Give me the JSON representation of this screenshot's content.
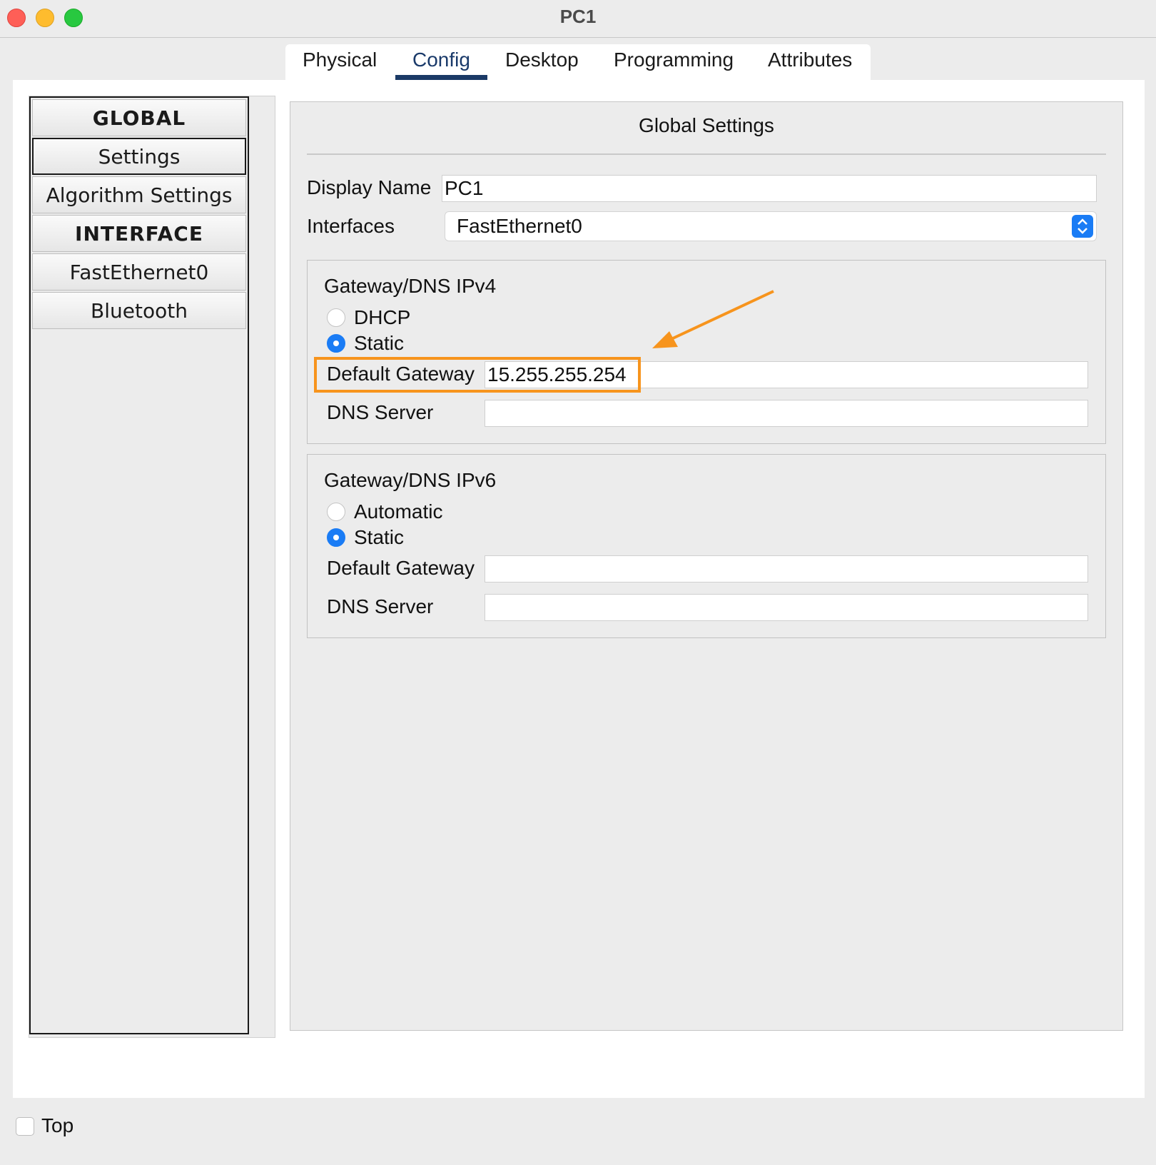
{
  "window": {
    "title": "PC1"
  },
  "tabs": [
    {
      "label": "Physical",
      "active": false
    },
    {
      "label": "Config",
      "active": true
    },
    {
      "label": "Desktop",
      "active": false
    },
    {
      "label": "Programming",
      "active": false
    },
    {
      "label": "Attributes",
      "active": false
    }
  ],
  "sidebar": {
    "items": [
      {
        "label": "GLOBAL",
        "kind": "header"
      },
      {
        "label": "Settings",
        "kind": "item",
        "selected": true
      },
      {
        "label": "Algorithm Settings",
        "kind": "item"
      },
      {
        "label": "INTERFACE",
        "kind": "header"
      },
      {
        "label": "FastEthernet0",
        "kind": "item"
      },
      {
        "label": "Bluetooth",
        "kind": "item"
      }
    ]
  },
  "global_settings": {
    "title": "Global Settings",
    "display_name_label": "Display Name",
    "display_name_value": "PC1",
    "interfaces_label": "Interfaces",
    "interfaces_value": "FastEthernet0"
  },
  "ipv4": {
    "title": "Gateway/DNS IPv4",
    "dhcp_label": "DHCP",
    "static_label": "Static",
    "selected": "Static",
    "gateway_label": "Default Gateway",
    "gateway_value": "15.255.255.254",
    "dns_label": "DNS Server",
    "dns_value": ""
  },
  "ipv6": {
    "title": "Gateway/DNS IPv6",
    "automatic_label": "Automatic",
    "static_label": "Static",
    "selected": "Static",
    "gateway_label": "Default Gateway",
    "gateway_value": "",
    "dns_label": "DNS Server",
    "dns_value": ""
  },
  "footer": {
    "top_label": "Top",
    "top_checked": false
  },
  "colors": {
    "accent": "#1a7cf5",
    "tab_underline": "#1b3a66",
    "annotation": "#f7941d",
    "window_bg": "#ececec"
  }
}
